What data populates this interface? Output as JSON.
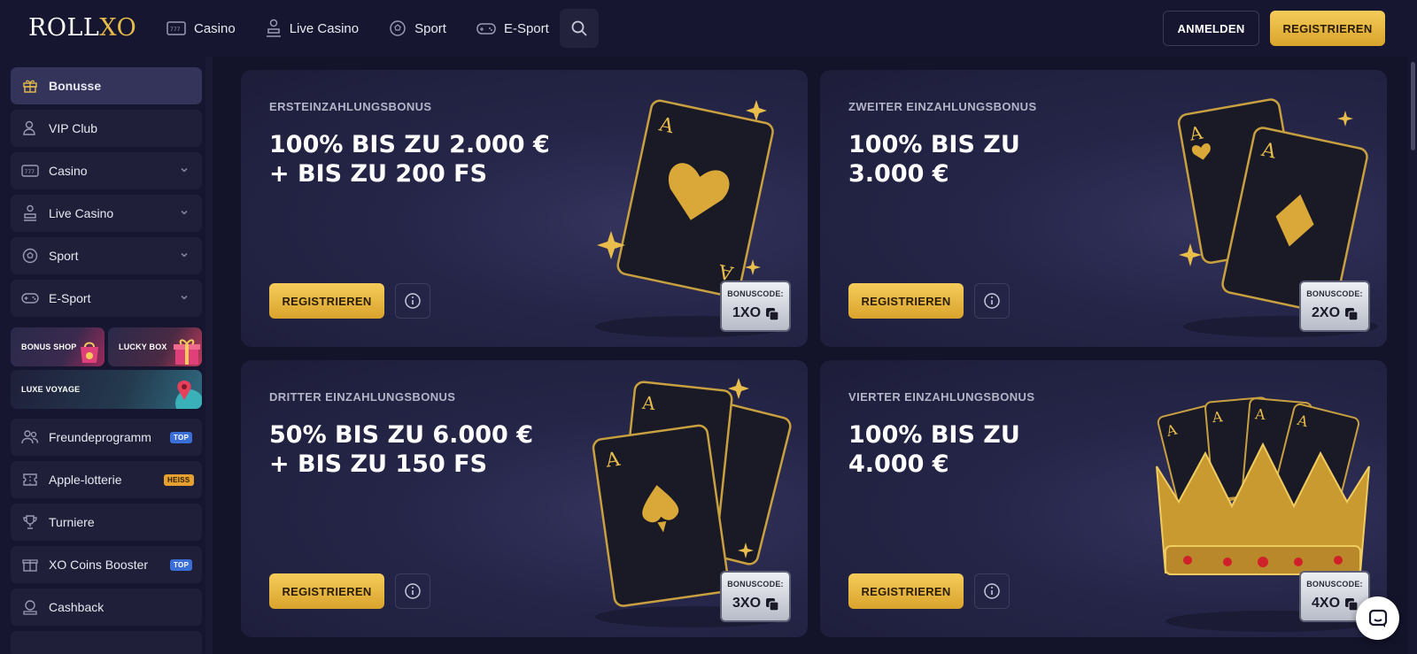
{
  "header": {
    "logo_roll": "ROLL",
    "logo_xo": "XO",
    "nav": [
      {
        "label": "Casino",
        "icon": "slot-machine-icon"
      },
      {
        "label": "Live Casino",
        "icon": "dealer-icon"
      },
      {
        "label": "Sport",
        "icon": "soccer-ball-icon"
      },
      {
        "label": "E-Sport",
        "icon": "gamepad-icon"
      }
    ],
    "login_label": "ANMELDEN",
    "register_label": "REGISTRIEREN"
  },
  "sidebar": {
    "items": [
      {
        "label": "Bonusse",
        "icon": "gift-icon",
        "active": true
      },
      {
        "label": "VIP Club",
        "icon": "vip-user-icon"
      },
      {
        "label": "Casino",
        "icon": "slot-machine-icon",
        "expandable": true
      },
      {
        "label": "Live Casino",
        "icon": "dealer-icon",
        "expandable": true
      },
      {
        "label": "Sport",
        "icon": "soccer-ball-icon",
        "expandable": true
      },
      {
        "label": "E-Sport",
        "icon": "gamepad-icon",
        "expandable": true
      }
    ],
    "promos": {
      "bonus_shop": "BONUS SHOP",
      "lucky_box": "LUCKY BOX",
      "luxe_voyage": "LUXE VOYAGE"
    },
    "items2": [
      {
        "label": "Freundeprogramm",
        "icon": "friends-icon",
        "badge": "TOP"
      },
      {
        "label": "Apple-lotterie",
        "icon": "ticket-icon",
        "badge": "HEISS"
      },
      {
        "label": "Turniere",
        "icon": "trophy-icon"
      },
      {
        "label": "XO Coins Booster",
        "icon": "coins-gift-icon",
        "badge": "TOP"
      },
      {
        "label": "Cashback",
        "icon": "cashback-icon"
      }
    ]
  },
  "bonuses": [
    {
      "subtitle": "ERSTEINZAHLUNGSBONUS",
      "title": "100% BIS ZU 2.000 €\n+ BIS ZU 200 FS",
      "button": "REGISTRIEREN",
      "code_label": "BONUSCODE:",
      "code": "1XO"
    },
    {
      "subtitle": "ZWEITER EINZAHLUNGSBONUS",
      "title": "100% BIS ZU\n3.000 €",
      "button": "REGISTRIEREN",
      "code_label": "BONUSCODE:",
      "code": "2XO"
    },
    {
      "subtitle": "DRITTER EINZAHLUNGSBONUS",
      "title": "50% BIS ZU 6.000 €\n+ BIS ZU 150 FS",
      "button": "REGISTRIEREN",
      "code_label": "BONUSCODE:",
      "code": "3XO"
    },
    {
      "subtitle": "VIERTER EINZAHLUNGSBONUS",
      "title": "100% BIS ZU\n4.000 €",
      "button": "REGISTRIEREN",
      "code_label": "BONUSCODE:",
      "code": "4XO"
    }
  ],
  "colors": {
    "accent_gold": "#e9bd4c",
    "background": "#13132a",
    "card": "#252548"
  }
}
